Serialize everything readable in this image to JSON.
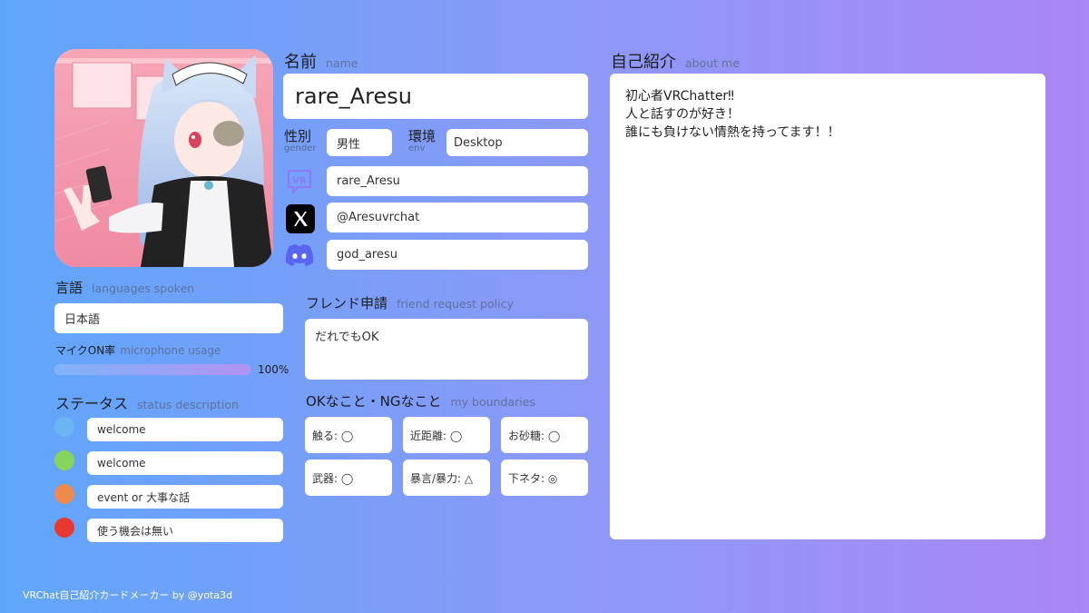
{
  "name": {
    "title": "名前",
    "title_sub": "name",
    "value": "rare_Aresu"
  },
  "gender": {
    "title": "性別",
    "title_sub": "gender",
    "value": "男性"
  },
  "env": {
    "title": "環境",
    "title_sub": "env",
    "value": "Desktop"
  },
  "accounts": {
    "vrchat": {
      "icon": "vrchat-icon",
      "value": "rare_Aresu"
    },
    "x": {
      "icon": "x-icon",
      "value": "@Aresuvrchat"
    },
    "discord": {
      "icon": "discord-icon",
      "value": "god_aresu"
    }
  },
  "about": {
    "title": "自己紹介",
    "title_sub": "about me",
    "lines": [
      "初心者VRChatter‼",
      "人と話すのが好き！",
      "誰にも負けない情熱を持ってます！！"
    ]
  },
  "languages": {
    "title": "言語",
    "title_sub": "languages spoken",
    "value": "日本語"
  },
  "mic": {
    "title": "マイクON率",
    "title_sub": "microphone usage",
    "percent": 100,
    "percent_label": "100%"
  },
  "status": {
    "title": "ステータス",
    "title_sub": "status description",
    "items": [
      {
        "color": "#6bb6f2",
        "label": "welcome"
      },
      {
        "color": "#86d45a",
        "label": "welcome"
      },
      {
        "color": "#ee8a4e",
        "label": "event or 大事な話"
      },
      {
        "color": "#e8382f",
        "label": "使う機会は無い"
      }
    ]
  },
  "friend": {
    "title": "フレンド申請",
    "title_sub": "friend request policy",
    "value": "だれでもOK"
  },
  "boundaries": {
    "title": "OKなこと・NGなこと",
    "title_sub": "my boundaries",
    "items": [
      "触る: ◯",
      "近距離: ◯",
      "お砂糖: ◯",
      "武器: ◯",
      "暴言/暴力: △",
      "下ネタ: ◎"
    ]
  },
  "footer": "VRChat自己紹介カードメーカー by @yota3d",
  "colors": {
    "vrchat": "#8b7cf6",
    "discord": "#5865f2",
    "x": "#000000"
  }
}
